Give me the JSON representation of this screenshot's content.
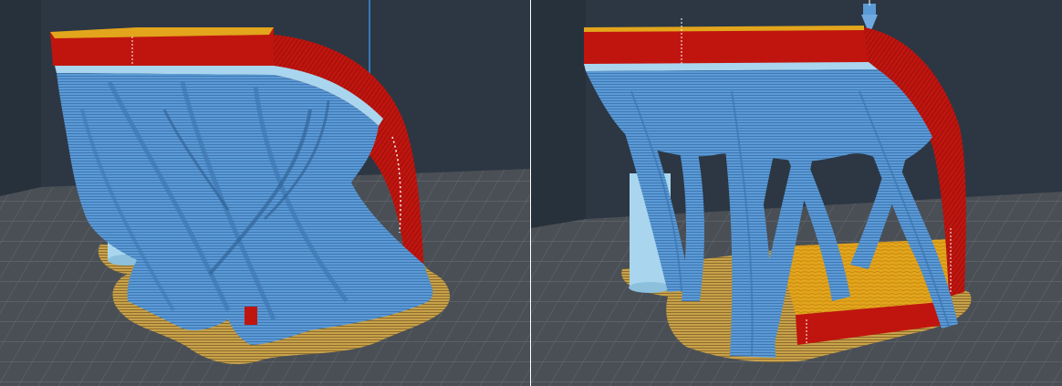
{
  "viewports": [
    {
      "name": "slice-preview-left",
      "support_style": "organic-grid",
      "colors": {
        "background": "#2c3743",
        "bed": "#4a4f55",
        "grid": "#6b7077",
        "brim": "#c8a14a",
        "support": "#5b9ad6",
        "support_dark": "#3f78b3",
        "interface": "#a9d6ee",
        "wall": "#c0150f",
        "top": "#e2a51c"
      }
    },
    {
      "name": "slice-preview-right",
      "support_style": "tree",
      "colors": {
        "background": "#2c3743",
        "bed": "#4a4f55",
        "grid": "#6b7077",
        "brim": "#c8a14a",
        "support": "#5b9ad6",
        "support_dark": "#3f78b3",
        "interface": "#a9d6ee",
        "wall": "#c0150f",
        "top": "#e2a51c"
      }
    }
  ],
  "icons": {
    "nozzle": "nozzle-icon",
    "axis": "z-axis-line"
  }
}
